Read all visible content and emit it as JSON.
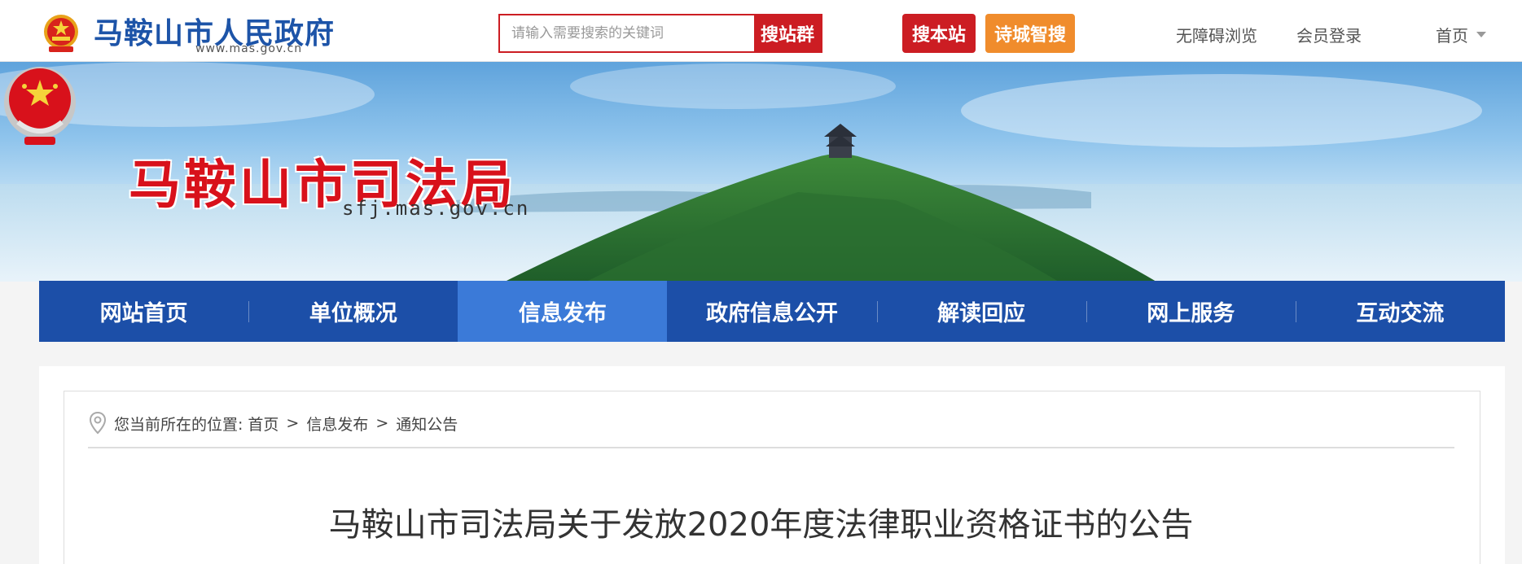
{
  "header": {
    "gov_name": "马鞍山市人民政府",
    "gov_url": "www.mas.gov.cn",
    "search": {
      "placeholder": "请输入需要搜索的关键词",
      "btn_group": "搜站群",
      "btn_site": "搜本站",
      "btn_poem": "诗城智搜"
    },
    "links": {
      "accessibility": "无障碍浏览",
      "login": "会员登录",
      "home": "首页"
    }
  },
  "banner": {
    "bureau_name": "马鞍山市司法局",
    "bureau_url": "sfj.mas.gov.cn"
  },
  "nav": {
    "items": [
      {
        "label": "网站首页"
      },
      {
        "label": "单位概况"
      },
      {
        "label": "信息发布"
      },
      {
        "label": "政府信息公开"
      },
      {
        "label": "解读回应"
      },
      {
        "label": "网上服务"
      },
      {
        "label": "互动交流"
      }
    ],
    "active_index": 2
  },
  "breadcrumb": {
    "prefix": "您当前所在的位置:",
    "items": [
      "首页",
      "信息发布",
      "通知公告"
    ],
    "separator": ">"
  },
  "article": {
    "title": "马鞍山市司法局关于发放2020年度法律职业资格证书的公告"
  },
  "colors": {
    "brand_red": "#cc1d23",
    "nav_blue": "#1c4fa8",
    "nav_active": "#3b7ad8",
    "poem_orange": "#f08c2c",
    "gov_blue": "#1d54a8"
  },
  "icons": {
    "gov_emblem": "national-emblem-icon",
    "bureau_emblem": "justice-emblem-icon",
    "location": "location-pin-icon",
    "dropdown": "caret-down-icon"
  }
}
